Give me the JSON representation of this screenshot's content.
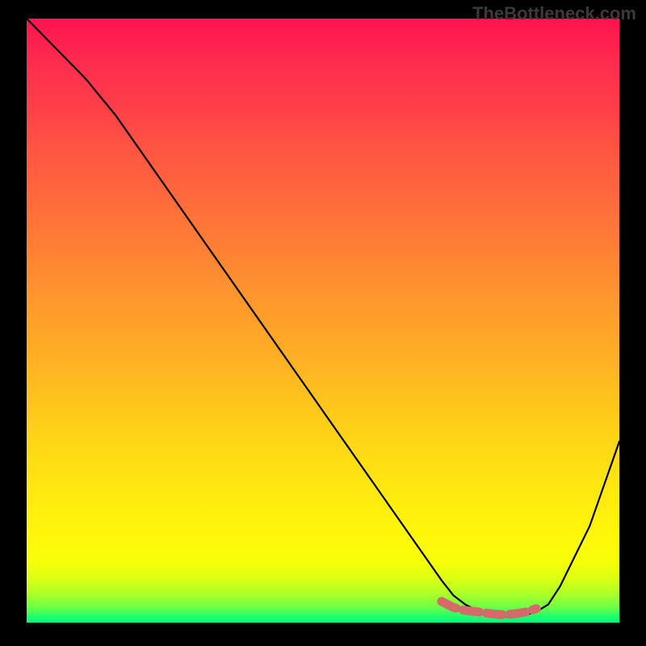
{
  "watermark": "TheBottleneck.com",
  "chart_data": {
    "type": "line",
    "title": "",
    "xlabel": "",
    "ylabel": "",
    "xlim": [
      0,
      100
    ],
    "ylim": [
      0,
      100
    ],
    "series": [
      {
        "name": "bottleneck-curve",
        "color": "#000000",
        "x": [
          0,
          5,
          10,
          15,
          20,
          25,
          30,
          35,
          40,
          45,
          50,
          55,
          60,
          65,
          70,
          72,
          74,
          76,
          78,
          80,
          82,
          84,
          86,
          88,
          90,
          95,
          100
        ],
        "y": [
          100,
          95,
          90,
          84,
          77,
          70,
          63,
          56,
          49,
          42,
          35,
          28,
          21,
          14,
          7,
          4.5,
          3,
          2,
          1.3,
          1,
          1,
          1.2,
          1.8,
          3,
          6,
          16,
          30
        ]
      },
      {
        "name": "optimal-range-marker",
        "color": "#d56a6a",
        "x": [
          70,
          72,
          74,
          76,
          78,
          80,
          82,
          84,
          86
        ],
        "y": [
          3.5,
          2.5,
          2,
          1.8,
          1.5,
          1.3,
          1.4,
          1.7,
          2.3
        ]
      }
    ],
    "gradient": {
      "top_color": "#ff1450",
      "mid_color": "#ffe810",
      "bottom_color": "#00ff80",
      "meaning": "red high bottleneck, green low bottleneck"
    }
  }
}
